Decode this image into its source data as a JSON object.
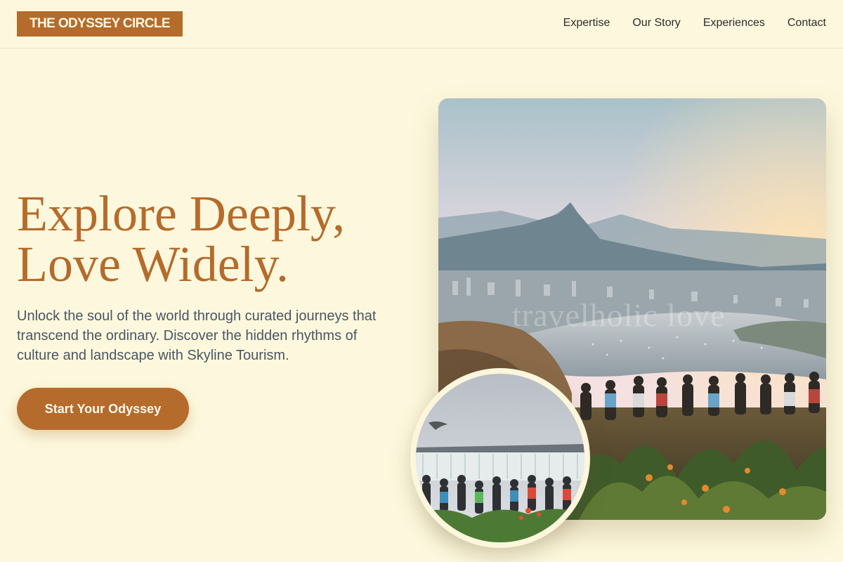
{
  "brand": {
    "name": "THE ODYSSEY CIRCLE",
    "color": "#b56b2b"
  },
  "nav": {
    "items": [
      {
        "label": "Expertise"
      },
      {
        "label": "Our Story"
      },
      {
        "label": "Experiences"
      },
      {
        "label": "Contact"
      }
    ]
  },
  "hero": {
    "title_line1": "Explore Deeply,",
    "title_line2": "Love Widely.",
    "subtitle": "Unlock the soul of the world through curated journeys that transcend the ordinary. Discover the hidden rhythms of culture and landscape with Skyline Tourism.",
    "cta_label": "Start Your Odyssey"
  },
  "images": {
    "main_alt": "Tourists at a mountain overlook above a coastal city at sunset",
    "main_watermark": "travelholic love",
    "inset_alt": "Crowd of visitors watching a large waterfall"
  },
  "colors": {
    "background": "#fdf8dd",
    "accent": "#b56b2b",
    "text": "#2b2b2b",
    "muted": "#4a5566"
  }
}
